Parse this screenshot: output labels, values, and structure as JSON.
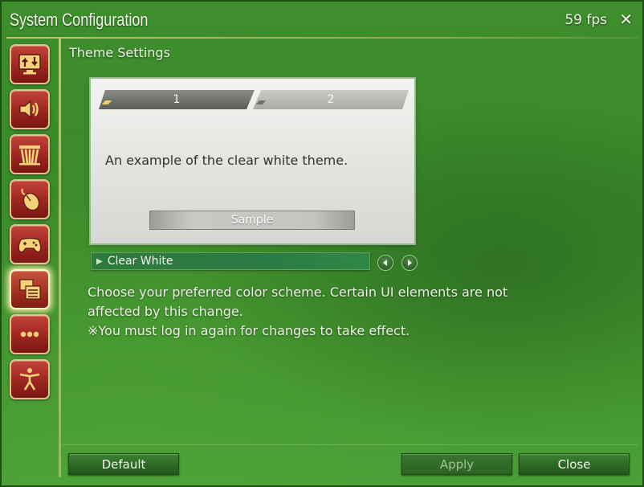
{
  "window": {
    "title": "System Configuration",
    "fps": "59 fps",
    "close_icon": "close-icon"
  },
  "sidebar": {
    "items": [
      {
        "name": "display-settings",
        "icon": "monitor-arrows-icon"
      },
      {
        "name": "sound-settings",
        "icon": "speaker-icon"
      },
      {
        "name": "other-settings",
        "icon": "bars-icon"
      },
      {
        "name": "mouse-settings",
        "icon": "mouse-icon"
      },
      {
        "name": "gamepad-settings",
        "icon": "gamepad-icon"
      },
      {
        "name": "theme-settings",
        "icon": "windows-icon",
        "active": true
      },
      {
        "name": "more-settings",
        "icon": "ellipsis-icon"
      },
      {
        "name": "accessibility-settings",
        "icon": "person-icon"
      }
    ]
  },
  "section": {
    "title": "Theme Settings"
  },
  "preview": {
    "tab1_label": "1",
    "tab2_label": "2",
    "text": "An example of the clear white theme.",
    "sample_button": "Sample"
  },
  "theme_select": {
    "value": "Clear White"
  },
  "description": {
    "line1": "Choose your preferred color scheme. Certain UI elements are not",
    "line2": "affected by this change.",
    "line3": "※You must log in again for changes to take effect."
  },
  "footer": {
    "default_label": "Default",
    "apply_label": "Apply",
    "close_label": "Close"
  },
  "colors": {
    "background": "#3e8e2e",
    "sidebar_button": "#9d2620",
    "sidebar_border": "#e1c38e",
    "accent_rule": "#e6be78"
  }
}
